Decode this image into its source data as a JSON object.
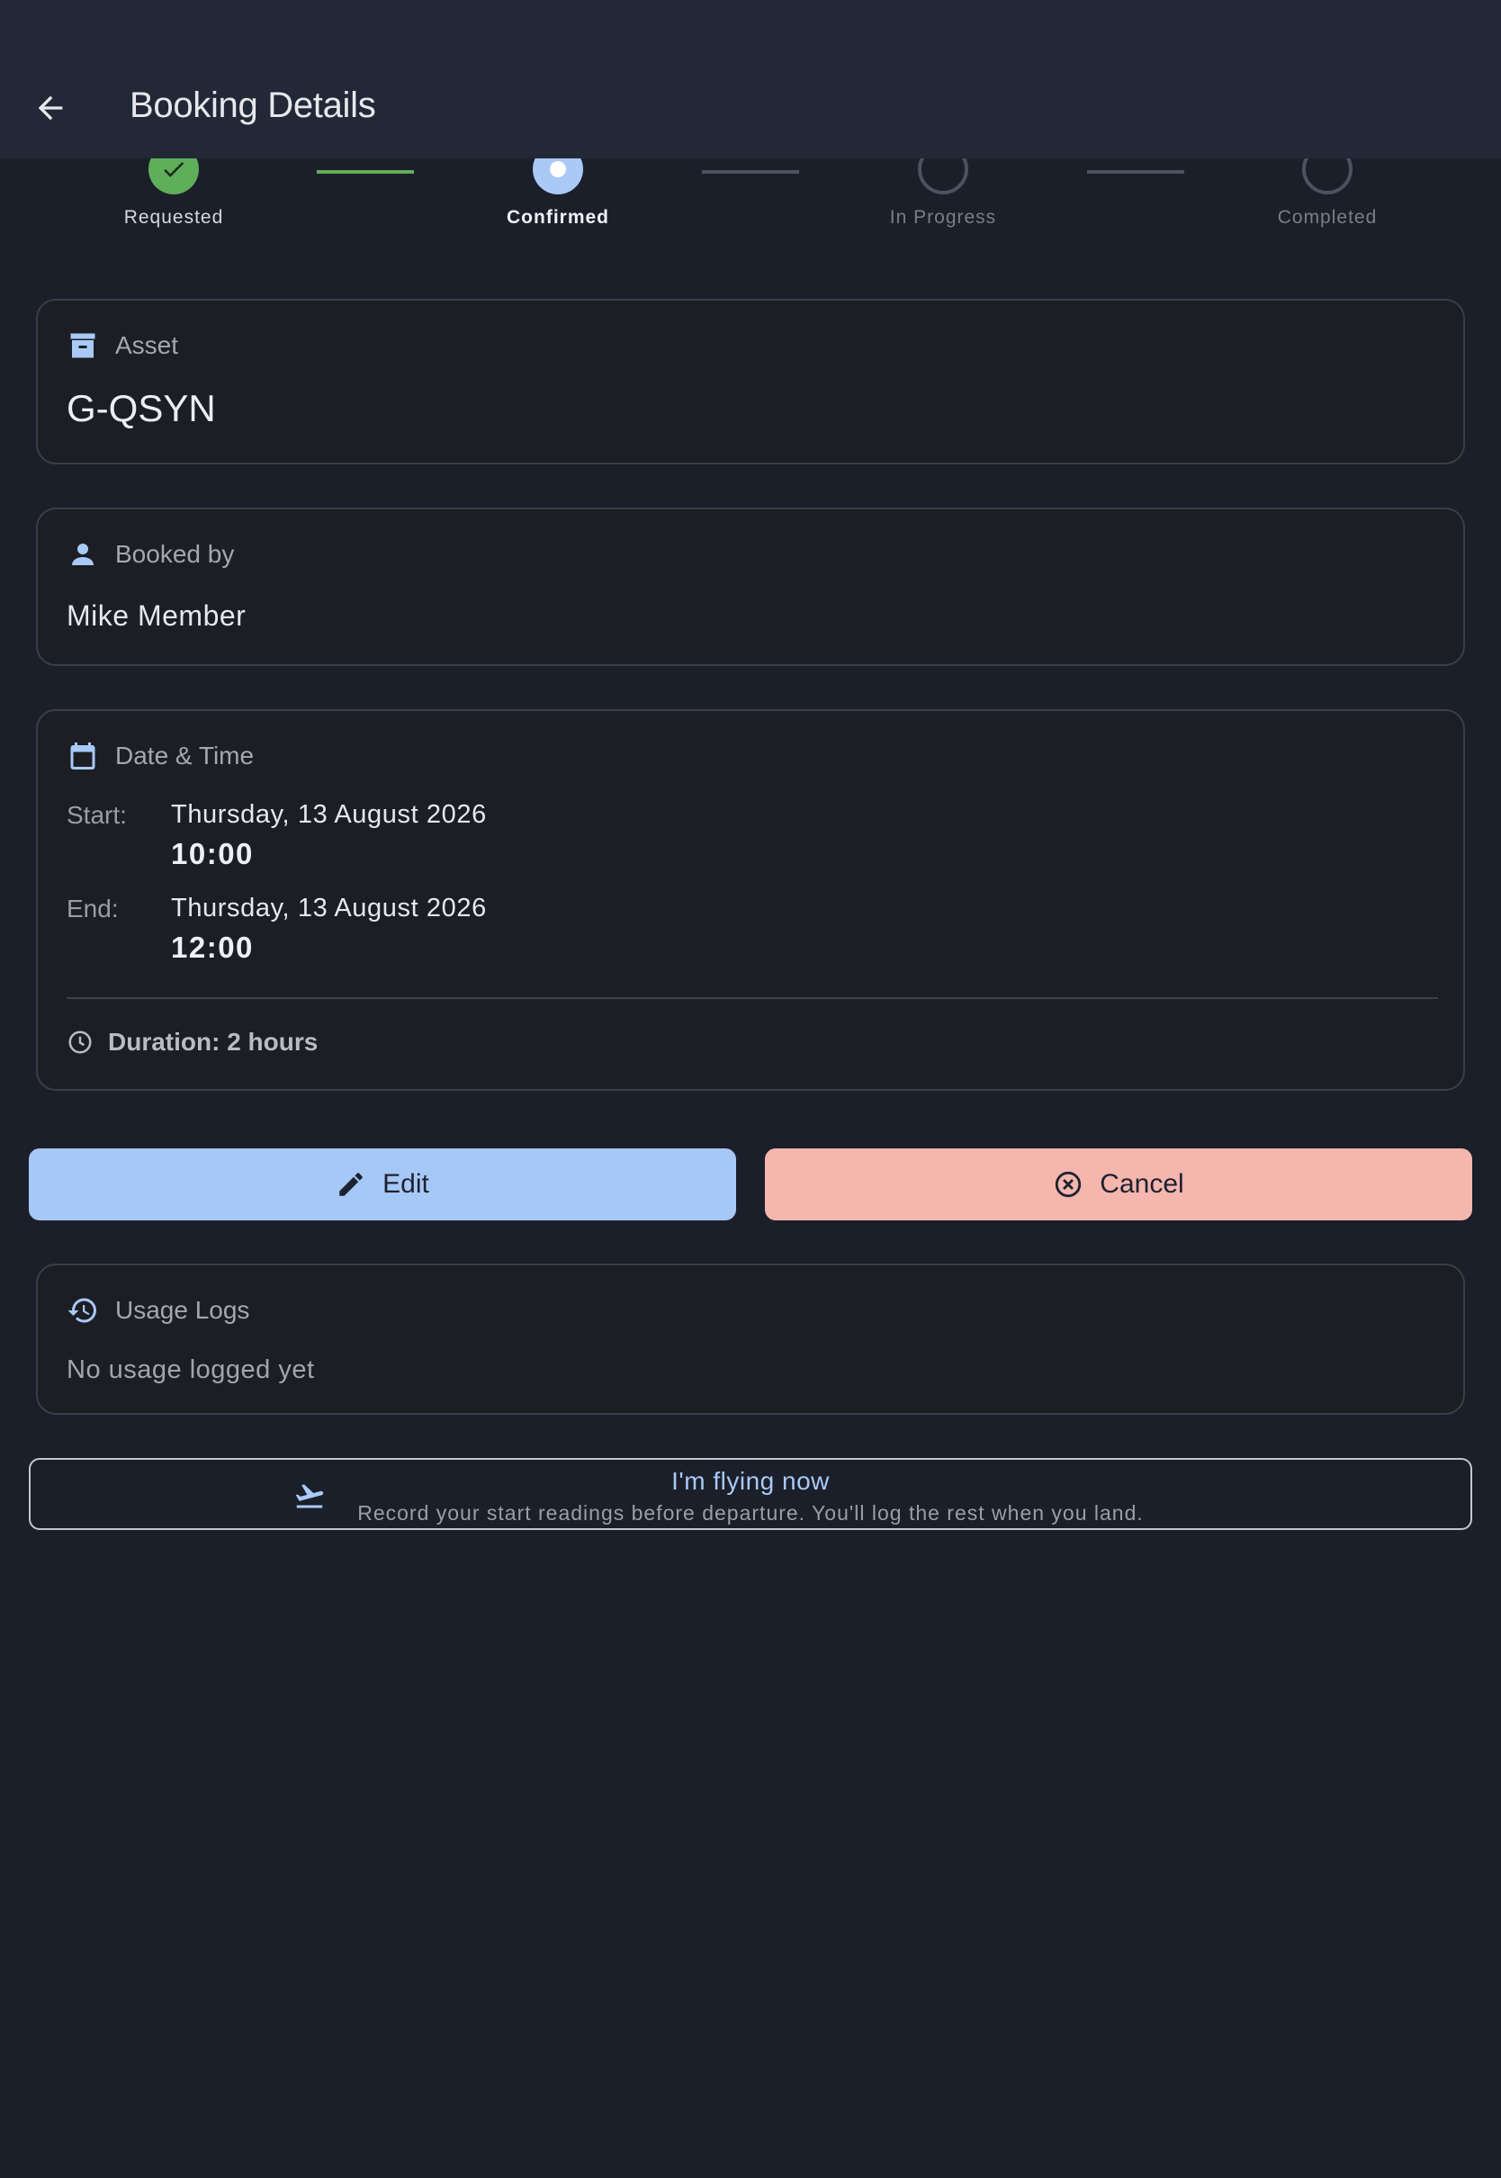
{
  "app_bar": {
    "title": "Booking Details",
    "back_icon": "arrow-left-icon"
  },
  "stepper": {
    "steps": [
      {
        "label": "Requested",
        "state": "done"
      },
      {
        "label": "Confirmed",
        "state": "active"
      },
      {
        "label": "In Progress",
        "state": "todo"
      },
      {
        "label": "Completed",
        "state": "todo"
      }
    ],
    "colors": {
      "done": "#5fae5a",
      "active": "#a9c9f7",
      "todo": "#4d5160"
    }
  },
  "asset_card": {
    "heading": "Asset",
    "icon": "archive-box-icon",
    "value": "G-QSYN"
  },
  "booked_by_card": {
    "heading": "Booked by",
    "icon": "person-icon",
    "value": "Mike Member"
  },
  "datetime_card": {
    "heading": "Date & Time",
    "icon": "calendar-icon",
    "start_label": "Start:",
    "start_date": "Thursday, 13 August 2026",
    "start_time": "10:00",
    "end_label": "End:",
    "end_date": "Thursday, 13 August 2026",
    "end_time": "12:00",
    "duration": "Duration: 2 hours",
    "duration_icon": "clock-icon"
  },
  "actions": {
    "edit_label": "Edit",
    "edit_icon": "pencil-icon",
    "cancel_label": "Cancel",
    "cancel_icon": "circle-x-icon",
    "edit_color": "#a6c8f7",
    "cancel_color": "#f4b6ad"
  },
  "usage_card": {
    "heading": "Usage Logs",
    "icon": "history-icon",
    "empty_text": "No usage logged yet"
  },
  "flying_button": {
    "title": "I'm flying now",
    "subtitle": "Record your start readings before departure. You'll log the rest when you land.",
    "icon": "flight-takeoff-icon"
  }
}
